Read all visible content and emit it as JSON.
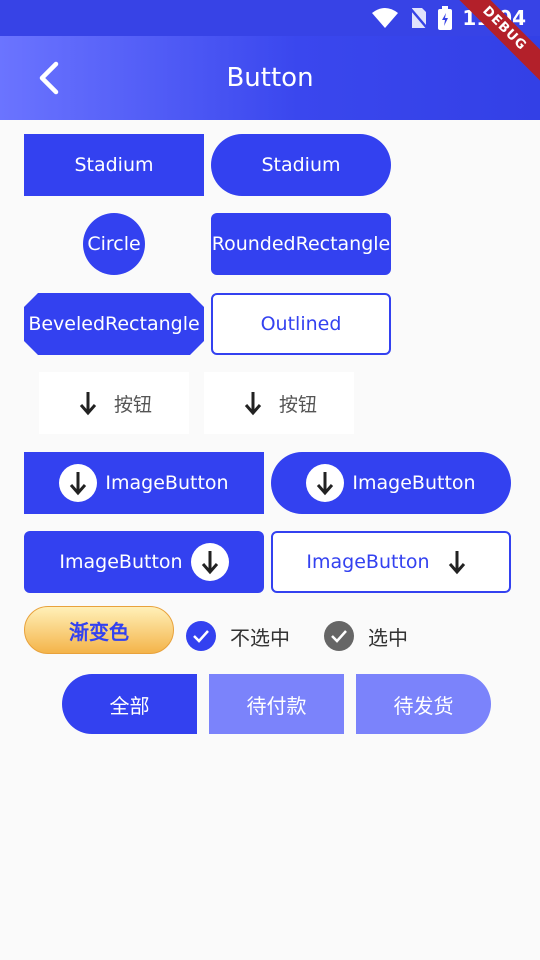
{
  "status": {
    "time": "11:04",
    "debug_label": "DEBUG"
  },
  "appbar": {
    "title": "Button"
  },
  "buttons": {
    "stadium1": "Stadium",
    "stadium2": "Stadium",
    "circle": "Circle",
    "rounded": "RoundedRectangle",
    "beveled": "BeveledRectangle",
    "outlined": "Outlined",
    "flat1": "按钮",
    "flat2": "按钮",
    "image1": "ImageButton",
    "image2": "ImageButton",
    "image3": "ImageButton",
    "image4": "ImageButton",
    "gradient": "渐变色"
  },
  "checks": {
    "unselected": "不选中",
    "selected": "选中"
  },
  "tabs": [
    "全部",
    "待付款",
    "待发货"
  ],
  "colors": {
    "primary": "#3341f0",
    "light": "#7b83fb",
    "gradient_start": "#fff0b8",
    "gradient_end": "#f4b44a"
  }
}
